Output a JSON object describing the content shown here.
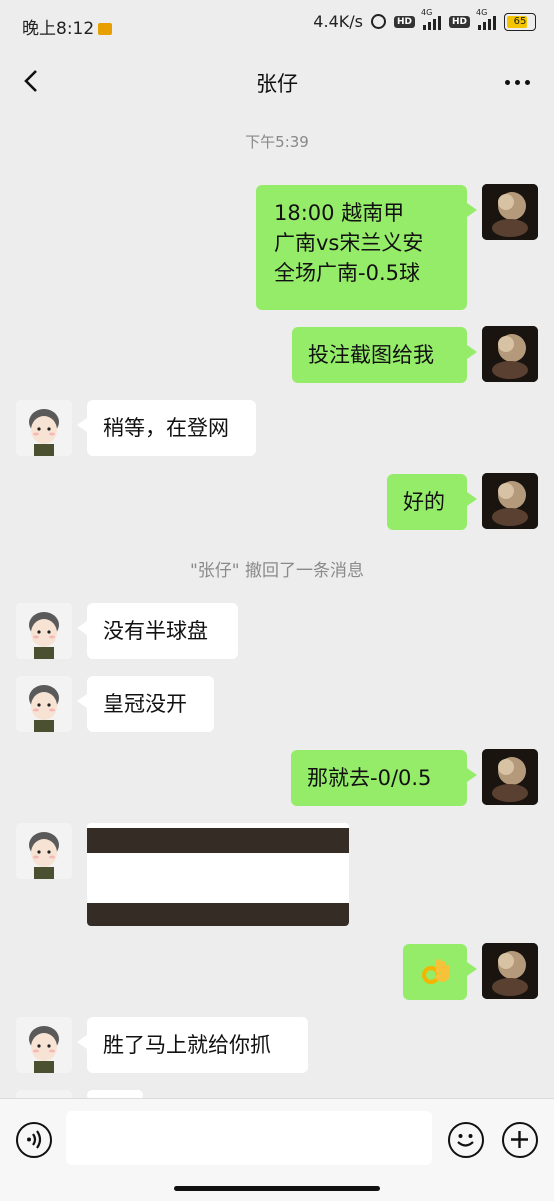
{
  "status_bar": {
    "time": "晚上8:12",
    "speed": "4.4K/s",
    "hd1": "HD",
    "hd2": "HD",
    "net1": "4G",
    "net2": "4G",
    "battery": "65"
  },
  "header": {
    "title": "张仔"
  },
  "timestamp": "下午5:39",
  "recall_notice": "\"张仔\" 撤回了一条消息",
  "messages": [
    {
      "sender": "me",
      "lines": [
        "18:00 越南甲",
        "广南vs宋兰义安",
        "全场广南-0.5球"
      ]
    },
    {
      "sender": "me",
      "text": "投注截图给我"
    },
    {
      "sender": "other",
      "text": "稍等，在登网"
    },
    {
      "sender": "me",
      "text": "好的"
    },
    {
      "sender": "other",
      "text": "没有半球盘"
    },
    {
      "sender": "other",
      "text": "皇冠没开"
    },
    {
      "sender": "me",
      "text": "那就去-0/0.5"
    },
    {
      "sender": "other",
      "type": "image"
    },
    {
      "sender": "me",
      "type": "emoji",
      "icon": "ok-hand-emoji"
    },
    {
      "sender": "other",
      "text": "胜了马上就给你抓"
    }
  ],
  "colors": {
    "me_bubble": "#95ec69",
    "other_bubble": "#ffffff",
    "background": "#ededed"
  }
}
